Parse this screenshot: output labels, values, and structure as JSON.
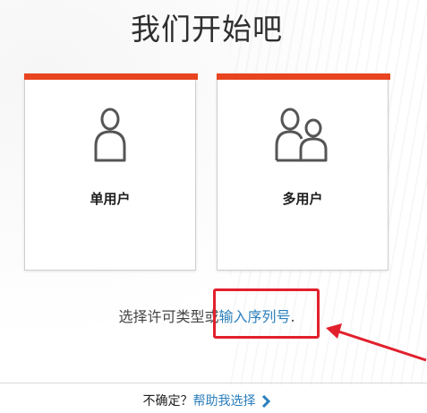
{
  "page": {
    "title": "我们开始吧"
  },
  "cards": {
    "single": {
      "label": "单用户",
      "icon": "single-user-icon"
    },
    "multi": {
      "label": "多用户",
      "icon": "multi-user-icon"
    }
  },
  "hint": {
    "prefix": "选择许可类型或",
    "serial_link": "输入序列号",
    "suffix": "."
  },
  "footer": {
    "question": "不确定？",
    "help_link": "帮助我选择",
    "chevron_icon": "chevron-right-icon"
  },
  "colors": {
    "accent": "#e8441f",
    "link": "#2b7fbd",
    "annotation": "#e2202c"
  }
}
